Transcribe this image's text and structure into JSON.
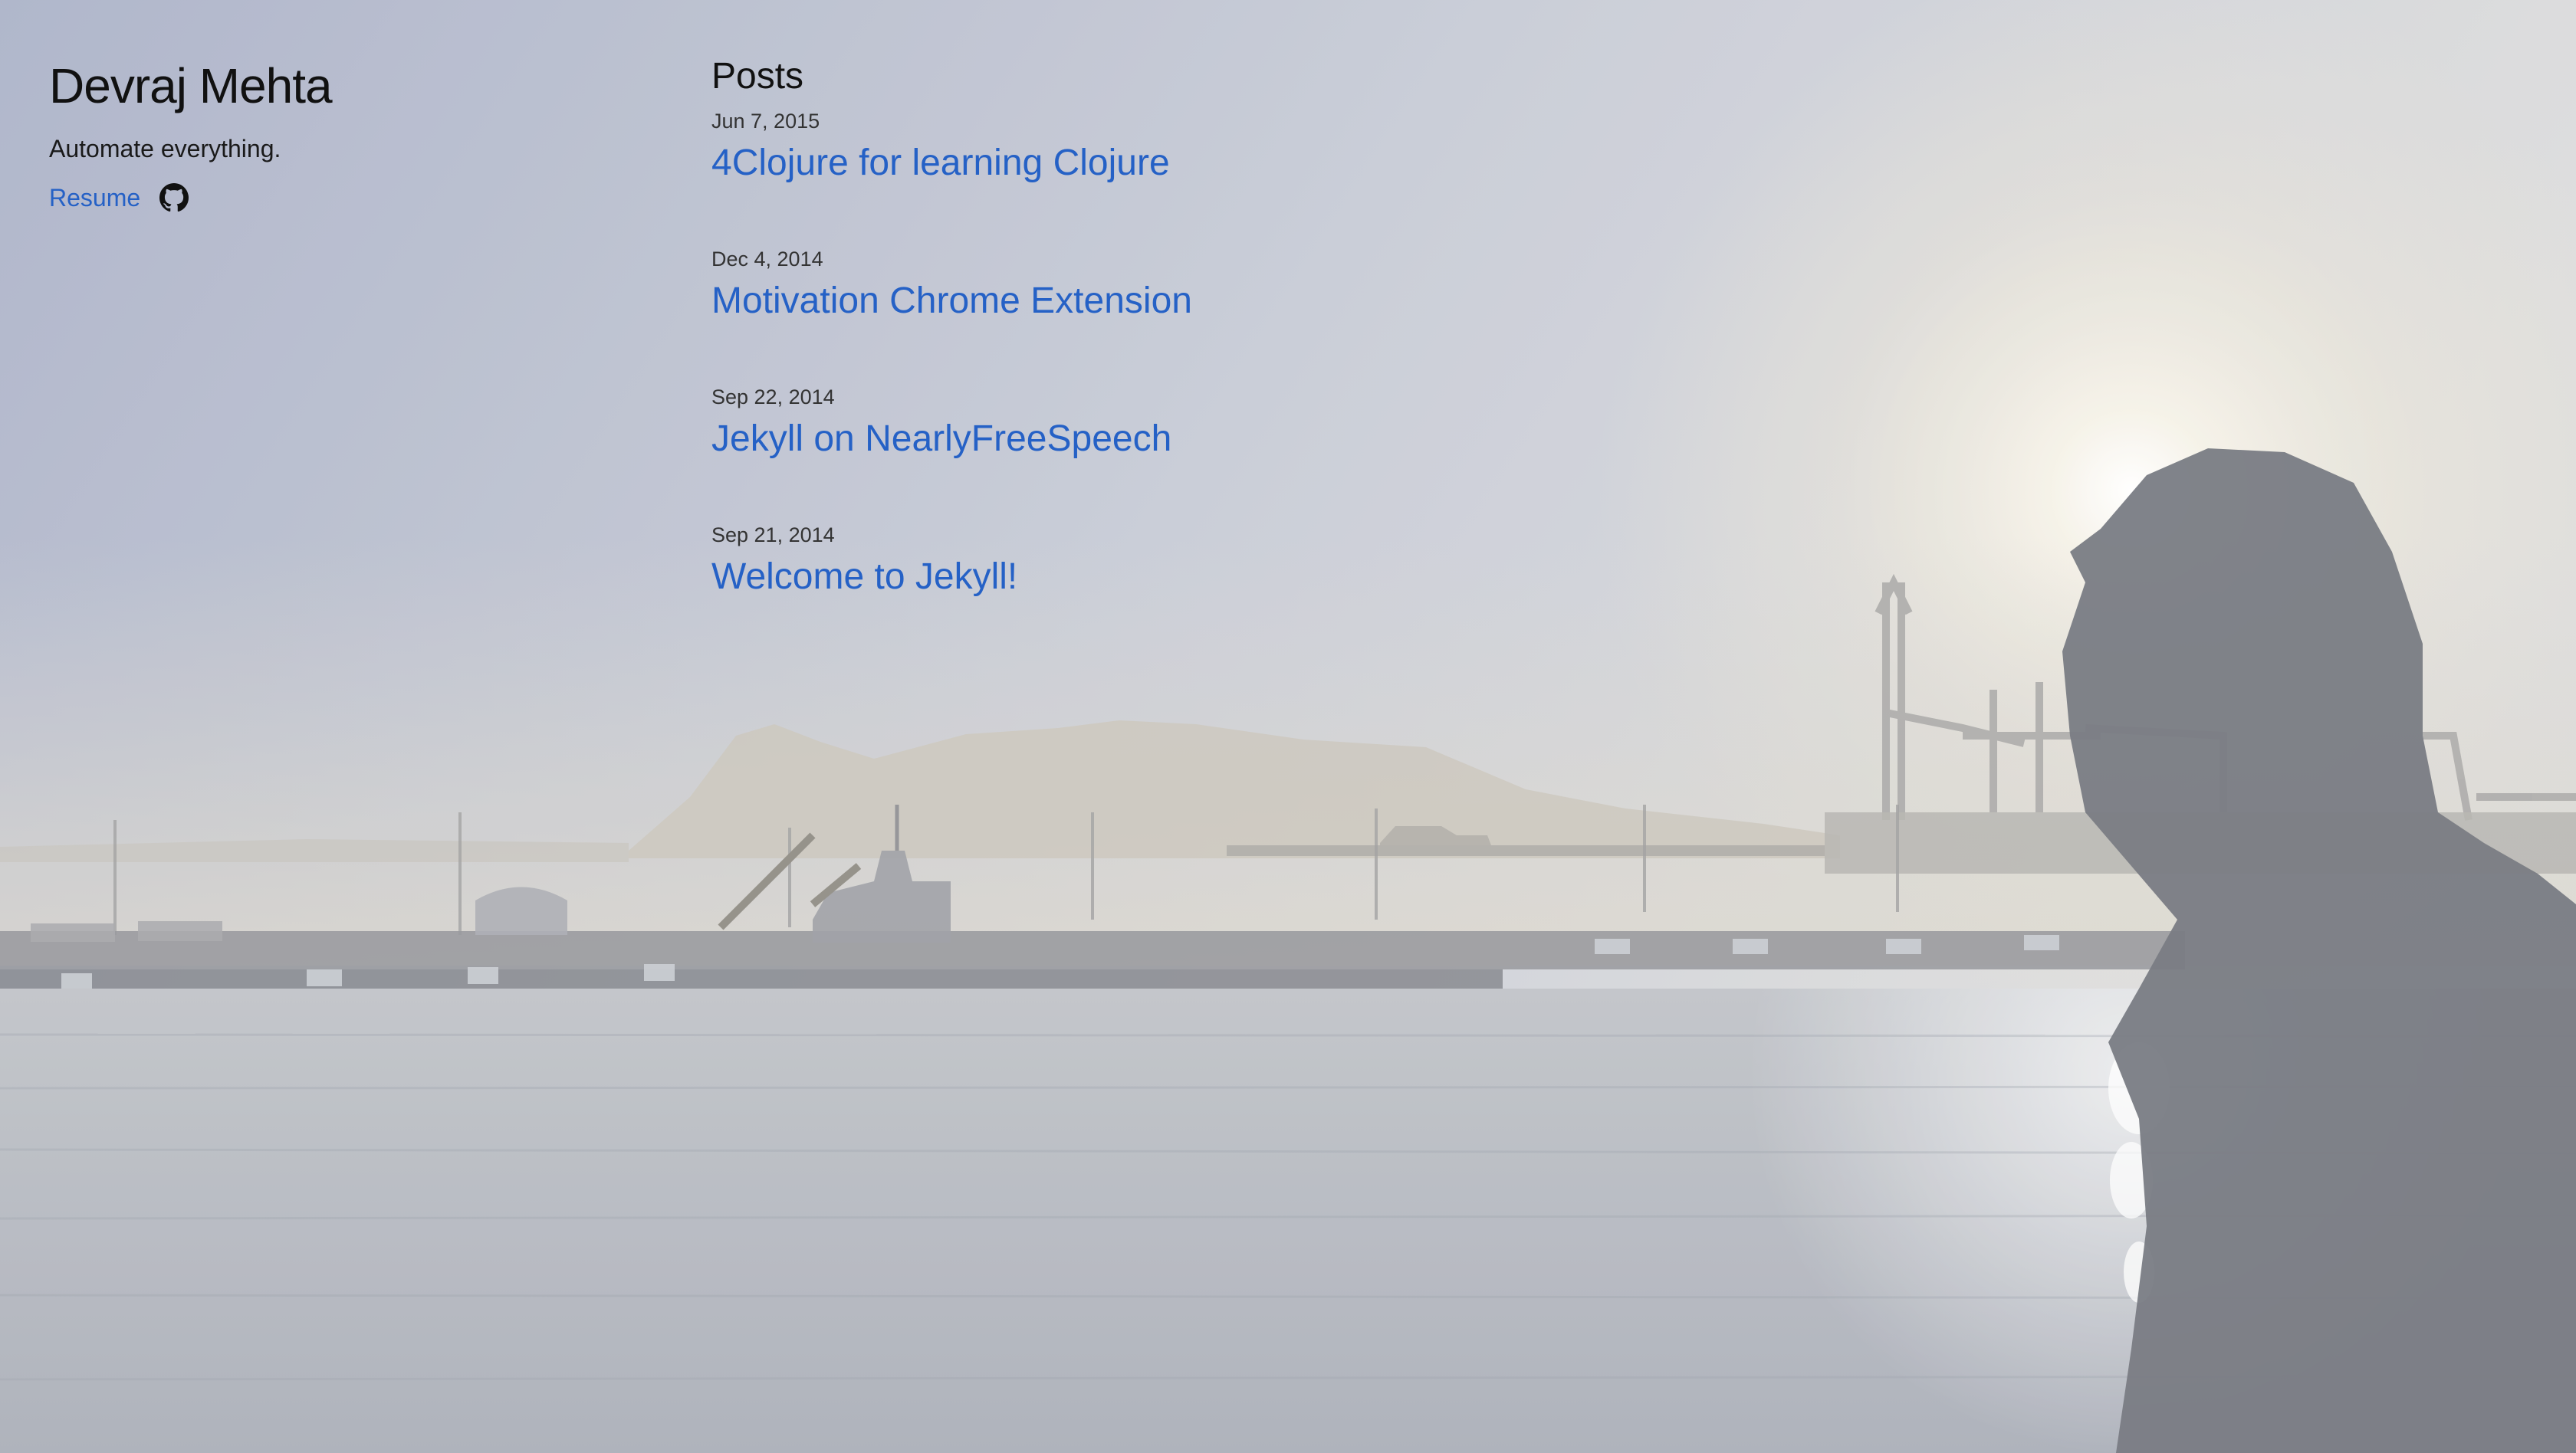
{
  "site": {
    "title": "Devraj Mehta",
    "tagline": "Automate everything.",
    "resume_label": "Resume",
    "github_icon": "github-icon"
  },
  "posts": {
    "heading": "Posts",
    "items": [
      {
        "date": "Jun 7, 2015",
        "title": "4Clojure for learning Clojure"
      },
      {
        "date": "Dec 4, 2014",
        "title": "Motivation Chrome Extension"
      },
      {
        "date": "Sep 22, 2014",
        "title": "Jekyll on NearlyFreeSpeech"
      },
      {
        "date": "Sep 21, 2014",
        "title": "Welcome to Jekyll!"
      }
    ]
  },
  "background": {
    "description_icon": "harbor-sunrise-photo",
    "sky_top": "#aeb4c9",
    "sky_glow": "#f1eee4",
    "water": "#b3b8c2",
    "silhouette": "#6e7178"
  },
  "colors": {
    "link": "#2561c6",
    "text": "#1e1e1e"
  }
}
